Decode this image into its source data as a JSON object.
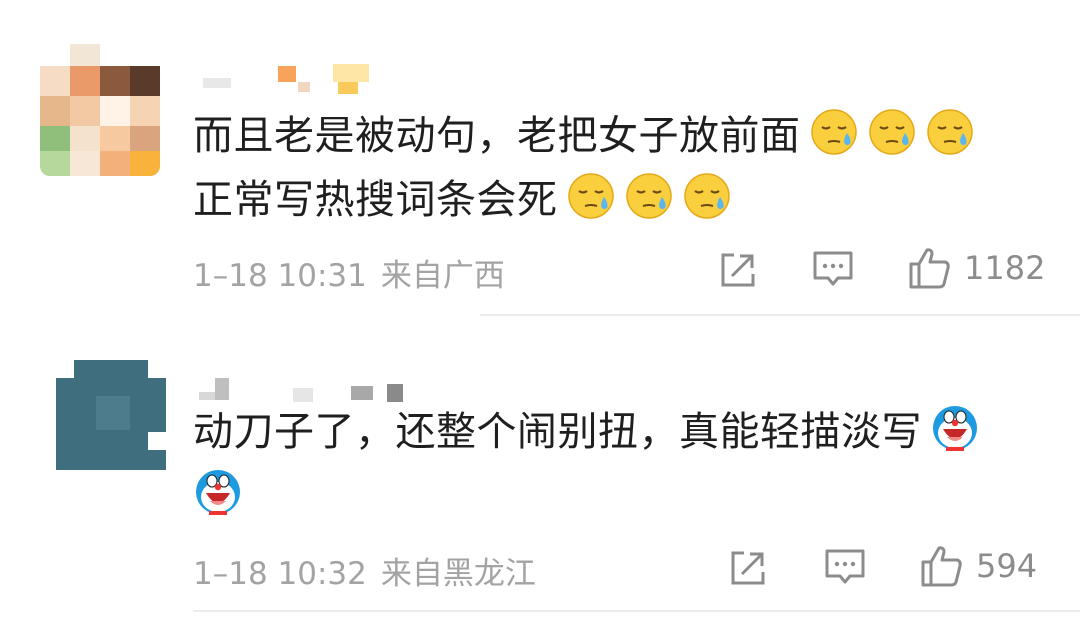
{
  "comments": [
    {
      "text_line1": "而且老是被动句，老把女子放前面",
      "text_line2": "正常写热搜词条会死",
      "emoji_line1": [
        "sweat-face-icon",
        "sweat-face-icon",
        "sweat-face-icon"
      ],
      "emoji_line2": [
        "sweat-face-icon",
        "sweat-face-icon",
        "sweat-face-icon"
      ],
      "time": "1–18 10:31",
      "location": "来自广西",
      "likes": "1182"
    },
    {
      "text_line1": "动刀子了，还整个闹别扭，真能轻描淡写",
      "emoji_line1": [
        "doraemon-laugh-icon"
      ],
      "emoji_line2": [
        "doraemon-laugh-icon"
      ],
      "time": "1–18 10:32",
      "location": "来自黑龙江",
      "likes": "594"
    }
  ],
  "icons": {
    "share": "share-icon",
    "comment": "comment-icon",
    "like": "thumbs-up-icon"
  },
  "colors": {
    "meta": "#a3a3a3",
    "divider": "#ececec",
    "text": "#1f1f1f"
  }
}
